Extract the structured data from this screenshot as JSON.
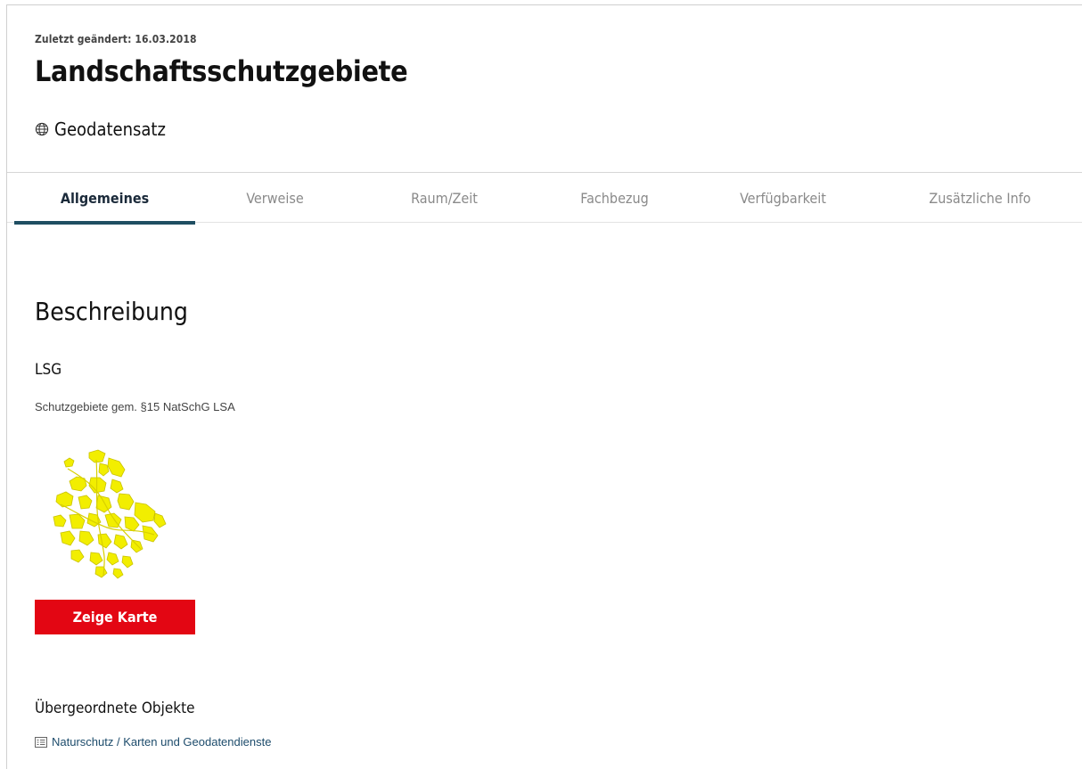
{
  "header": {
    "last_modified": "Zuletzt geändert: 16.03.2018",
    "title": "Landschaftsschutzgebiete",
    "type_label": "Geodatensatz",
    "type_icon": "globe-icon"
  },
  "tabs": [
    {
      "label": "Allgemeines",
      "active": true
    },
    {
      "label": "Verweise",
      "active": false
    },
    {
      "label": "Raum/Zeit",
      "active": false
    },
    {
      "label": "Fachbezug",
      "active": false
    },
    {
      "label": "Verfügbarkeit",
      "active": false
    },
    {
      "label": "Zusätzliche Info",
      "active": false
    }
  ],
  "description": {
    "heading": "Beschreibung",
    "short_name": "LSG",
    "text": "Schutzgebiete gem. §15 NatSchG LSA"
  },
  "map_button_label": "Zeige Karte",
  "parents": {
    "heading": "Übergeordnete Objekte",
    "link_label": "Naturschutz / Karten und Geodatendienste",
    "link_icon": "folder-list-icon"
  },
  "colors": {
    "accent": "#e30613",
    "tab_indicator": "#1f4e62",
    "link": "#1c4b6b",
    "map_fill": "#f2ee00"
  }
}
